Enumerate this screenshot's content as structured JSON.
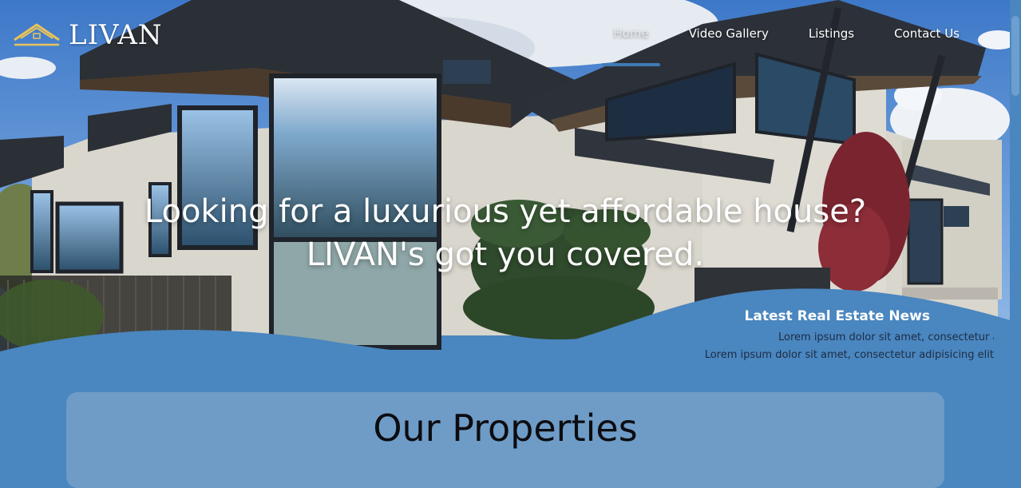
{
  "brand": {
    "name": "LIVAN",
    "logo_icon": "house-roof-icon",
    "logo_color": "#e8c35a"
  },
  "nav": {
    "items": [
      {
        "label": "Home",
        "active": true
      },
      {
        "label": "Video Gallery",
        "active": false
      },
      {
        "label": "Listings",
        "active": false
      },
      {
        "label": "Contact Us",
        "active": false
      }
    ]
  },
  "hero": {
    "headline_line1": "Looking for a luxurious yet affordable house?",
    "headline_line2": "LIVAN's got you covered."
  },
  "news": {
    "title": "Latest Real Estate News",
    "lines": [
      "Lorem ipsum dolor sit amet, consectetur adipisicing elit",
      "Lorem ipsum dolor sit amet, consectetur adipisicing elit"
    ]
  },
  "properties": {
    "title": "Our Properties"
  },
  "colors": {
    "accent": "#4a86bf",
    "card": "#6e9cc7"
  }
}
